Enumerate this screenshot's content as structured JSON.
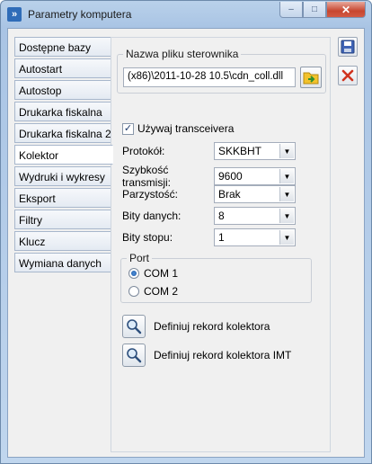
{
  "window": {
    "title": "Parametry komputera",
    "close_label": "✕",
    "minimize_label": "–",
    "maximize_label": "□"
  },
  "tabs": [
    {
      "label": "Dostępne bazy",
      "active": false
    },
    {
      "label": "Autostart",
      "active": false
    },
    {
      "label": "Autostop",
      "active": false
    },
    {
      "label": "Drukarka fiskalna",
      "active": false
    },
    {
      "label": "Drukarka fiskalna 2",
      "active": false
    },
    {
      "label": "Kolektor",
      "active": true
    },
    {
      "label": "Wydruki i wykresy",
      "active": false
    },
    {
      "label": "Eksport",
      "active": false
    },
    {
      "label": "Filtry",
      "active": false
    },
    {
      "label": "Klucz",
      "active": false
    },
    {
      "label": "Wymiana danych",
      "active": false
    }
  ],
  "driver": {
    "group_label": "Nazwa pliku sterownika",
    "value": "(x86)\\2011-10-28 10.5\\cdn_coll.dll"
  },
  "transceiver": {
    "label": "Używaj transceivera",
    "checked": true
  },
  "settings": [
    {
      "label": "Protokół:",
      "value": "SKKBHT"
    },
    {
      "label": "Szybkość transmisji:",
      "value": "9600"
    },
    {
      "label": "Parzystość:",
      "value": "Brak"
    },
    {
      "label": "Bity danych:",
      "value": "8"
    },
    {
      "label": "Bity stopu:",
      "value": "1"
    }
  ],
  "port": {
    "group_label": "Port",
    "options": [
      {
        "label": "COM 1",
        "selected": true
      },
      {
        "label": "COM 2",
        "selected": false
      }
    ]
  },
  "actions": [
    {
      "label": "Definiuj rekord kolektora",
      "icon": "magnifier-icon"
    },
    {
      "label": "Definiuj rekord kolektora IMT",
      "icon": "magnifier-icon"
    }
  ],
  "toolbar": {
    "save_icon": "floppy-disk-icon",
    "cancel_icon": "red-x-icon"
  },
  "colors": {
    "accent_blue": "#2f6cb8",
    "cancel_red": "#d0331f",
    "browse_yellow": "#f2c22c",
    "browse_green": "#3aa53a"
  }
}
